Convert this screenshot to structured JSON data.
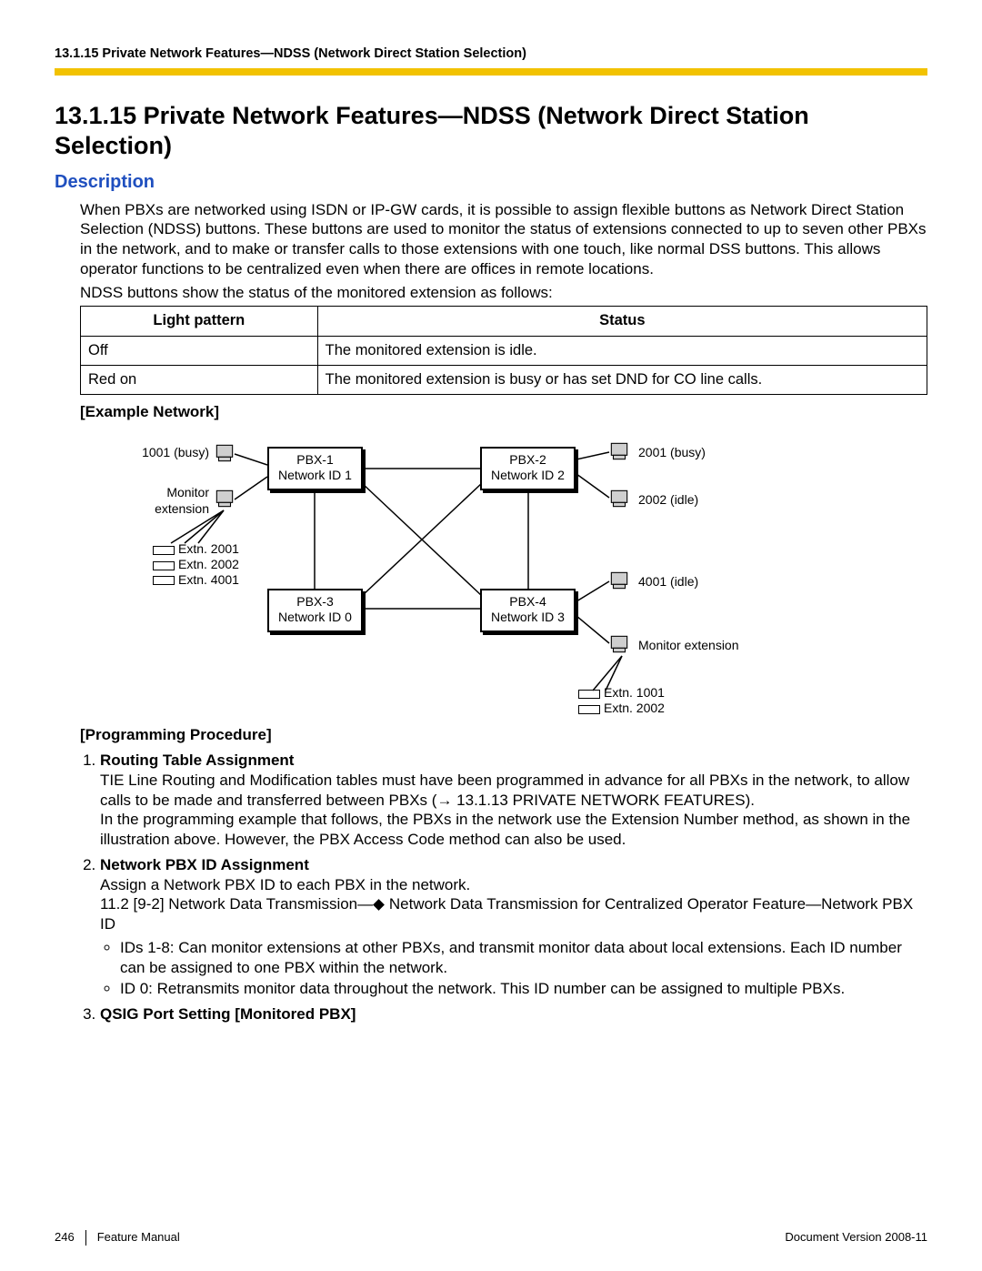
{
  "running_head": "13.1.15 Private Network Features—NDSS (Network Direct Station Selection)",
  "title": "13.1.15  Private Network Features—NDSS (Network Direct Station Selection)",
  "description_heading": "Description",
  "description_para1": "When PBXs are networked using ISDN or IP-GW cards, it is possible to assign flexible buttons as Network Direct Station Selection (NDSS) buttons. These buttons are used to monitor the status of extensions connected to up to seven other PBXs in the network, and to make or transfer calls to those extensions with one touch, like normal DSS buttons. This allows operator functions to be centralized even when there are offices in remote locations.",
  "description_para2": "NDSS buttons show the status of the monitored extension as follows:",
  "table": {
    "headers": [
      "Light pattern",
      "Status"
    ],
    "rows": [
      [
        "Off",
        "The monitored extension is idle."
      ],
      [
        "Red on",
        "The monitored extension is busy or has set DND for CO line calls."
      ]
    ]
  },
  "example_heading": "[Example Network]",
  "diagram": {
    "pbx": [
      {
        "name": "PBX-1",
        "nid": "Network ID 1"
      },
      {
        "name": "PBX-2",
        "nid": "Network ID 2"
      },
      {
        "name": "PBX-3",
        "nid": "Network ID 0"
      },
      {
        "name": "PBX-4",
        "nid": "Network ID 3"
      }
    ],
    "labels": {
      "l1001": "1001 (busy)",
      "lmon": "Monitor\nextension",
      "l2001": "2001 (busy)",
      "l2002": "2002 (idle)",
      "l4001": "4001 (idle)",
      "rmon": "Monitor extension"
    },
    "ext_left": [
      "Extn. 2001",
      "Extn. 2002",
      "Extn. 4001"
    ],
    "ext_right": [
      "Extn. 1001",
      "Extn. 2002"
    ]
  },
  "prog_heading": "[Programming Procedure]",
  "proc": {
    "i1": {
      "title": "Routing Table Assignment",
      "p1a": "TIE Line Routing and Modification tables must have been programmed in advance for all PBXs in the network, to allow calls to be made and transferred between PBXs (",
      "p1b": " 13.1.13  PRIVATE NETWORK FEATURES).",
      "p2": "In the programming example that follows, the PBXs in the network use the Extension Number method, as shown in the illustration above. However, the PBX Access Code method can also be used."
    },
    "i2": {
      "title": "Network PBX ID Assignment",
      "p1": "Assign a Network PBX ID to each PBX in the network.",
      "p2a": "11.2  [9-2] Network Data Transmission—",
      "p2b": " Network Data Transmission for Centralized Operator Feature—Network PBX ID",
      "b1": "IDs 1-8: Can monitor extensions at other PBXs, and transmit monitor data about local extensions. Each ID number can be assigned to one PBX within the network.",
      "b2": "ID 0: Retransmits monitor data throughout the network. This ID number can be assigned to multiple PBXs."
    },
    "i3": {
      "title": "QSIG Port Setting [Monitored PBX]"
    }
  },
  "footer": {
    "page": "246",
    "manual": "Feature Manual",
    "docver": "Document Version  2008-11"
  }
}
